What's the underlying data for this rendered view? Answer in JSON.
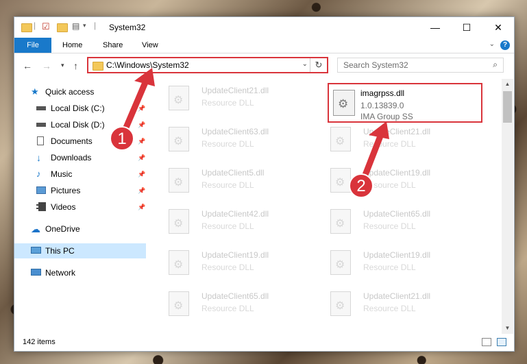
{
  "window": {
    "title": "System32"
  },
  "ribbon": {
    "tabs": [
      "File",
      "Home",
      "Share",
      "View"
    ],
    "help": "?"
  },
  "address": {
    "path": "C:\\Windows\\System32"
  },
  "search": {
    "placeholder": "Search System32"
  },
  "sidebar": {
    "items": [
      {
        "label": "Quick access",
        "icon": "star-icon"
      },
      {
        "label": "Local Disk (C:)",
        "icon": "drive-icon",
        "pinned": true
      },
      {
        "label": "Local Disk (D:)",
        "icon": "drive-icon",
        "pinned": true
      },
      {
        "label": "Documents",
        "icon": "document-icon",
        "pinned": true
      },
      {
        "label": "Downloads",
        "icon": "download-icon",
        "pinned": true
      },
      {
        "label": "Music",
        "icon": "music-icon",
        "pinned": true
      },
      {
        "label": "Pictures",
        "icon": "picture-icon",
        "pinned": true
      },
      {
        "label": "Videos",
        "icon": "video-icon",
        "pinned": true
      },
      {
        "label": "OneDrive",
        "icon": "cloud-icon"
      },
      {
        "label": "This PC",
        "icon": "computer-icon",
        "selected": true
      },
      {
        "label": "Network",
        "icon": "network-icon"
      }
    ]
  },
  "files": {
    "highlighted": {
      "name": "imagrpss.dll",
      "version": "1.0.13839.0",
      "company": "IMA Group SS"
    },
    "left_column": [
      {
        "name": "UpdateClient21.dll",
        "type": "Resource DLL"
      },
      {
        "name": "UpdateClient63.dll",
        "type": "Resource DLL"
      },
      {
        "name": "UpdateClient5.dll",
        "type": "Resource DLL"
      },
      {
        "name": "UpdateClient42.dll",
        "type": "Resource DLL"
      },
      {
        "name": "UpdateClient19.dll",
        "type": "Resource DLL"
      },
      {
        "name": "UpdateClient65.dll",
        "type": "Resource DLL"
      }
    ],
    "right_column": [
      {
        "name": "UpdateClient21.dll",
        "type": "Resource DLL"
      },
      {
        "name": "UpdateClient19.dll",
        "type": "Resource DLL"
      },
      {
        "name": "UpdateClient65.dll",
        "type": "Resource DLL"
      },
      {
        "name": "UpdateClient19.dll",
        "type": "Resource DLL"
      },
      {
        "name": "UpdateClient21.dll",
        "type": "Resource DLL"
      }
    ]
  },
  "status": {
    "item_count": "142 items"
  },
  "annotations": {
    "step1": "1",
    "step2": "2",
    "color": "#d9343b"
  }
}
